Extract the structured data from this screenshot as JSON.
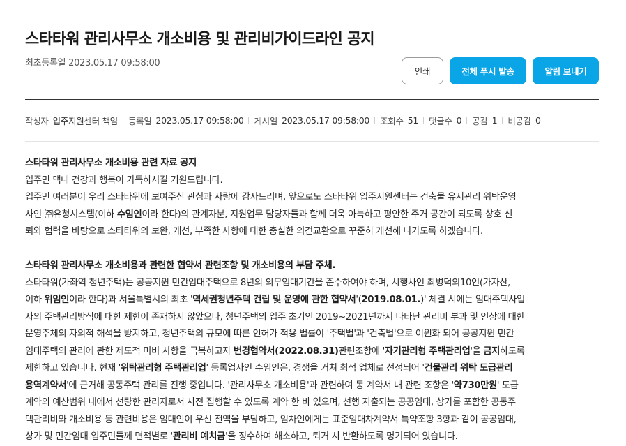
{
  "post": {
    "title": "스타타워 관리사무소 개소비용 및 관리비가이드라인 공지",
    "registered": "최초등록일 2023.05.17 09:58:00"
  },
  "buttons": {
    "print": "인쇄",
    "push_all": "전체 푸시 발송",
    "send_alarm": "알림 보내기"
  },
  "meta": {
    "author_label": "작성자",
    "author": "입주지원센터 책임",
    "reg_label": "등록일",
    "reg_date": "2023.05.17 09:58:00",
    "post_label": "게시일",
    "post_date": "2023.05.17 09:58:00",
    "views_label": "조회수",
    "views": "51",
    "comments_label": "댓글수",
    "comments": "0",
    "likes_label": "공감",
    "likes": "1",
    "dislikes_label": "비공감",
    "dislikes": "0"
  },
  "body": {
    "s1_heading": "스타타워 관리사무소 개소비용 관련 자료 공지",
    "s1_l1": "입주민 댁내 건강과 행복이 가득하시길 기원드립니다.",
    "s1_l2": "입주민 여러분이 우리 스타타워에 보여주신 관심과 사랑에 감사드리며, 앞으로도 스타타워 입주지원센터는 건축물 유지관리 위탁운영",
    "s1_l3a": "사인 ㈜유청시스템(이하 ",
    "s1_l3b": "수임인",
    "s1_l3c": "이라 한다)의 관계자분, 지원업무 담당자들과 함께 더욱 아늑하고 평안한 주거 공간이 되도록 상호 신",
    "s1_l4": "뢰와 협력을 바탕으로 스타타워의 보완, 개선, 부족한 사항에 대한 충실한 의견교환으로 꾸준히 개선해 나가도록 하겠습니다.",
    "s2_heading": "스타타워 관리사무소 개소비용과 관련한 협약서 관련조항 및 개소비용의 부담 주체.",
    "s2_l1": "스타타워(가좌역 청년주택)는 공공지원 민간임대주택으로 8년의 의무임대기간을 준수하여야 하며, 시행사인 최병덕외10인(가자산,",
    "s2_l2a": "이하 ",
    "s2_l2b": "위임인",
    "s2_l2c": "이라 한다)과 서울특별시의 최초 '",
    "s2_l2d": "역세권청년주택 건립 및 운영에 관한 협약서",
    "s2_l2e": "'(",
    "s2_l2f": "2019.08.01.",
    "s2_l2g": ")' 체결 시에는 임대주택사업",
    "s2_l3": "자의 주택관리방식에 대한 제한이 존재하지 않았으나, 청년주택의 입주 초기인 2019~2021년까지 나타난 관리비 부과 및 인상에 대한",
    "s2_l4": "운영주체의 자의적 해석을 방지하고, 청년주택의 규모에 따른 인허가 적용 법률이 '주택법'과 '건축법'으로 이원화 되어 공공지원 민간",
    "s2_l5a": "임대주택의 관리에 관한 제도적 미비 사항을 극복하고자 ",
    "s2_l5b": "변경협약서(2022.08.31)",
    "s2_l5c": "관련조항에 '",
    "s2_l5d": "자기관리형 주택관리업",
    "s2_l5e": "'을 ",
    "s2_l5f": "금지",
    "s2_l5g": "하도록",
    "s2_l6a": "제한하고 있습니다. 현재 '",
    "s2_l6b": "위탁관리형 주택관리업",
    "s2_l6c": "' 등록업자인 수임인은, 경쟁을 거쳐 최적 업체로 선정되어 '",
    "s2_l6d": "건물관리 위탁 도급관리",
    "s2_l7a": "용역계약서",
    "s2_l7b": "'에 근거해 공동주택 관리를 진행 중입니다. '",
    "s2_l7c": "관리사무소 개소비용",
    "s2_l7d": "'과 관련하여 동 계약서 내 관련 조항은 '",
    "s2_l7e": "약730만원",
    "s2_l7f": "' 도급",
    "s2_l8": "계약의 예산범위 내에서 선량한 관리자로서 사전 집행할 수 있도록 계약 한 바 있으며, 선행 지출되는 공공임대, 상가를 포함한 공동주",
    "s2_l9": "택관리비와 개소비용 등 관련비용은 임대인이 우선 전액을 부담하고, 임차인에게는 표준임대차계약서 특약조항 3항과 같이 공공임대,",
    "s2_l10a": "상가 및 민간임대 입주민들께 면적별로 '",
    "s2_l10b": "관리비 예치금",
    "s2_l10c": "'을 징수하여 해소하고, 퇴거 시 반환하도록 명기되어 있습니다."
  }
}
